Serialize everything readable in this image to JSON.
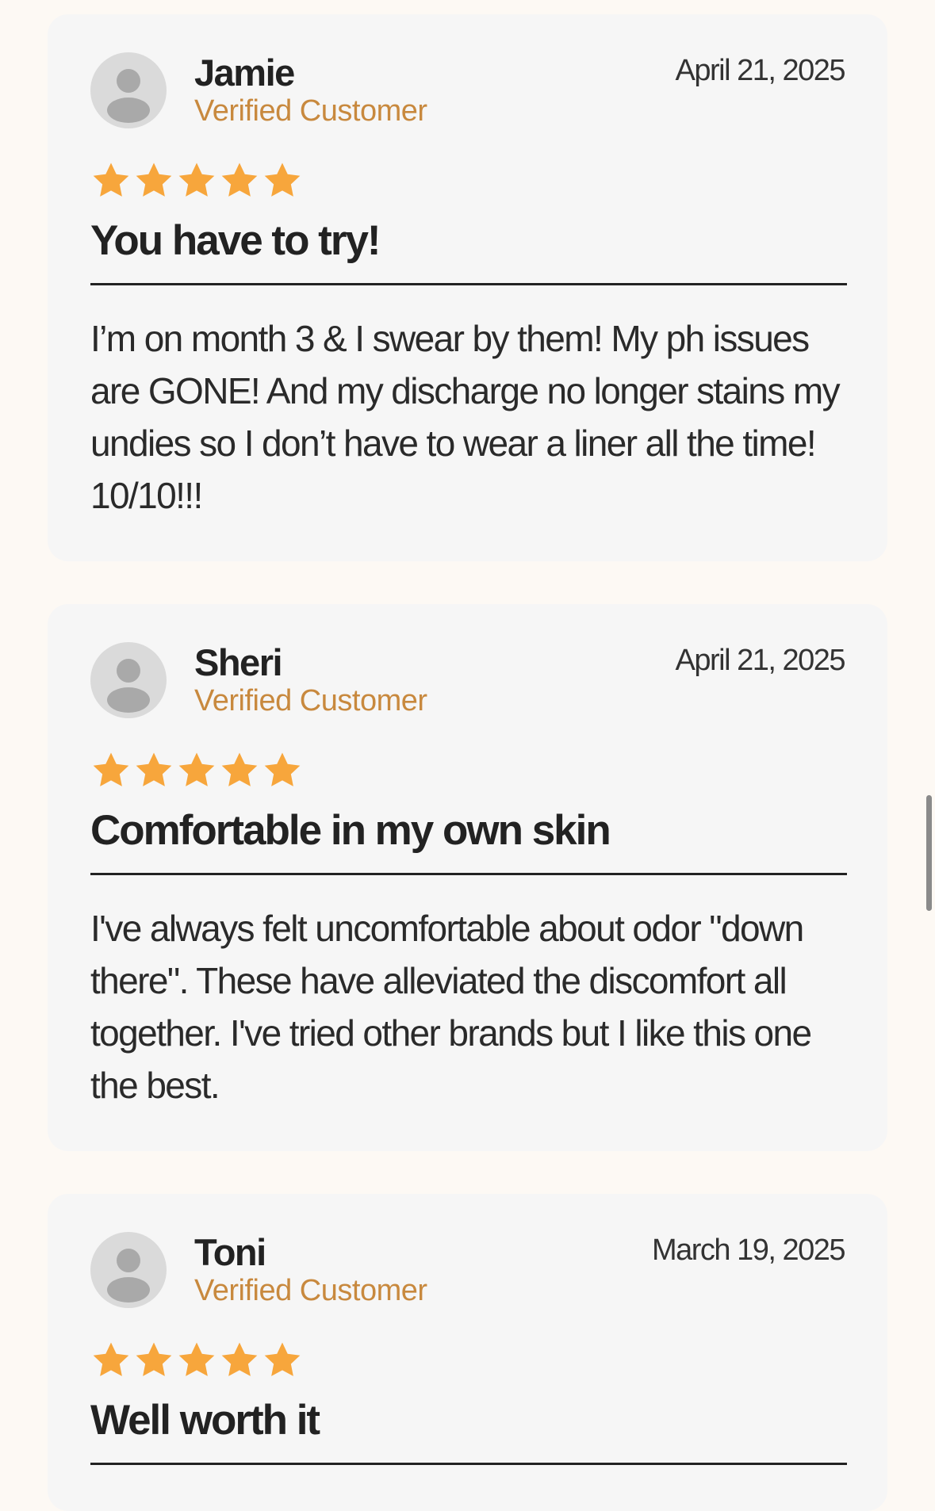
{
  "reviews": [
    {
      "name": "Jamie",
      "badge": "Verified Customer",
      "date": "April 21, 2025",
      "rating": 5,
      "title": "You have to try!",
      "body": "I’m on month 3 & I swear by them! My ph issues are GONE! And my discharge no longer stains my undies so I don’t have to wear a liner all the time! 10/10!!!"
    },
    {
      "name": "Sheri",
      "badge": "Verified Customer",
      "date": "April 21, 2025",
      "rating": 5,
      "title": "Comfortable in my own skin",
      "body": "I've always felt uncomfortable about odor \"down there\". These have alleviated the discomfort all together. I've tried other brands but I like this one the best."
    },
    {
      "name": "Toni",
      "badge": "Verified Customer",
      "date": "March 19, 2025",
      "rating": 5,
      "title": "Well worth it",
      "body": ""
    }
  ],
  "colors": {
    "star": "#f7a63c",
    "badge": "#c8893e",
    "card": "#f6f6f6",
    "page": "#fdf9f4"
  },
  "icons": {
    "avatar": "user-silhouette-icon",
    "star": "star-icon"
  }
}
